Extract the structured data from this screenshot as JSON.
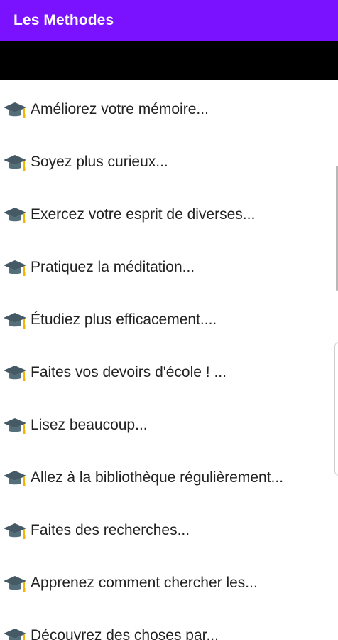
{
  "app": {
    "title": "Les Methodes"
  },
  "colors": {
    "appbar": "#7b12ff",
    "banner": "#000000",
    "icon_dark": "#455a64",
    "icon_tassel": "#f2b600"
  },
  "list": {
    "icon": "graduation-cap-icon",
    "items": [
      {
        "label": "Améliorez votre mémoire..."
      },
      {
        "label": "Soyez plus curieux..."
      },
      {
        "label": "Exercez votre esprit de diverses..."
      },
      {
        "label": "Pratiquez la méditation..."
      },
      {
        "label": "Étudiez plus efficacement...."
      },
      {
        "label": "Faites vos devoirs d'école ! ..."
      },
      {
        "label": "Lisez beaucoup..."
      },
      {
        "label": "Allez à la bibliothèque régulièrement..."
      },
      {
        "label": "Faites des recherches..."
      },
      {
        "label": "Apprenez comment chercher les..."
      },
      {
        "label": "Découvrez des choses par..."
      }
    ]
  }
}
